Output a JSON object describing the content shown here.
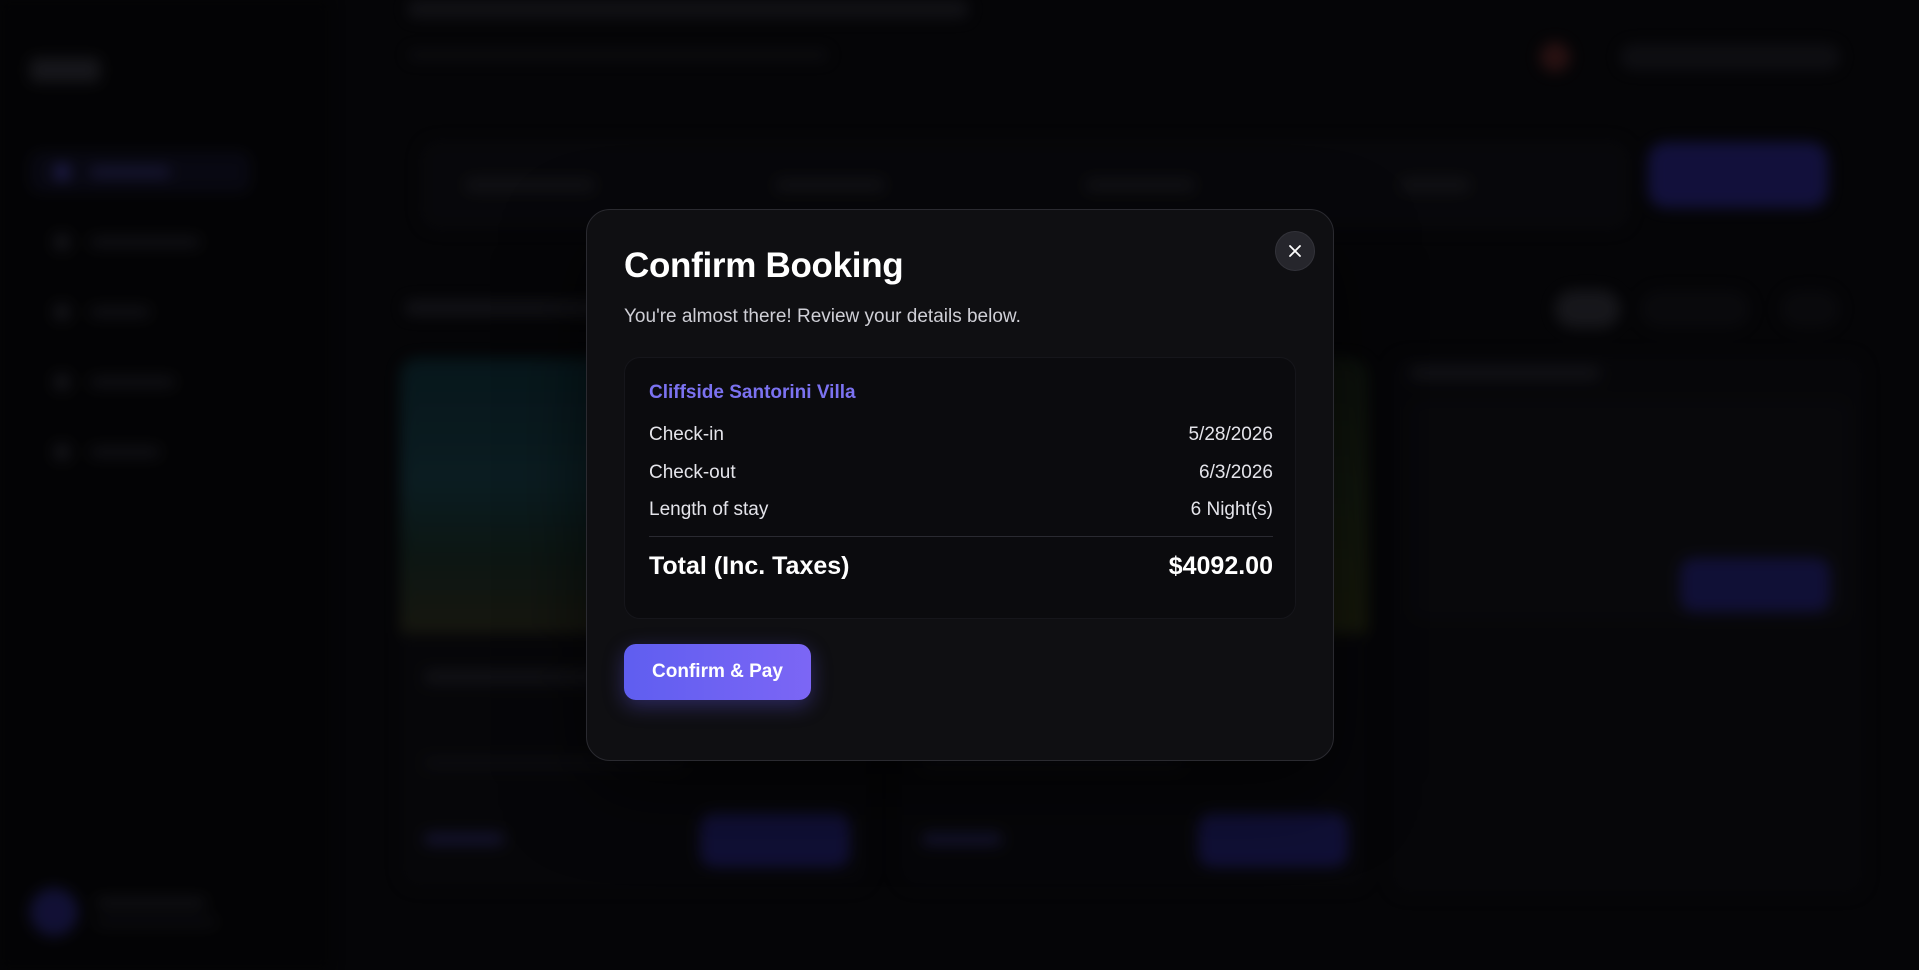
{
  "modal": {
    "title": "Confirm Booking",
    "subtitle": "You're almost there! Review your details below.",
    "close_icon": "close-icon",
    "summary": {
      "property_name": "Cliffside Santorini Villa",
      "rows": [
        {
          "label": "Check-in",
          "value": "5/28/2026"
        },
        {
          "label": "Check-out",
          "value": "6/3/2026"
        },
        {
          "label": "Length of stay",
          "value": "6 Night(s)"
        }
      ],
      "total": {
        "label": "Total (Inc. Taxes)",
        "value": "$4092.00"
      }
    },
    "confirm_button_label": "Confirm & Pay"
  },
  "colors": {
    "accent": "#6c63ff",
    "property_name": "#7b72f0",
    "modal_bg": "#0f0f12",
    "summary_bg": "#0b0b0e",
    "page_bg": "#08080b"
  }
}
